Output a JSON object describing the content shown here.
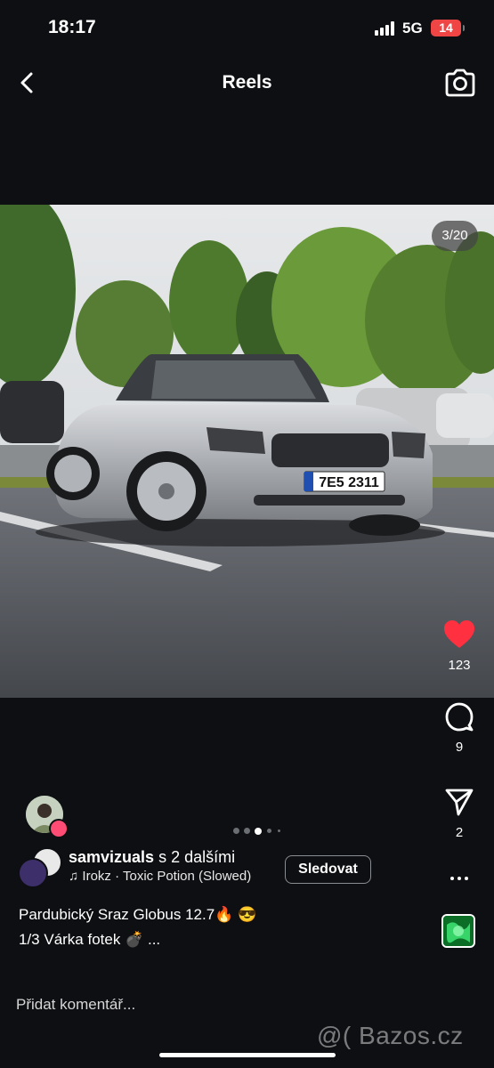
{
  "status_bar": {
    "time": "18:17",
    "network": "5G",
    "battery": "14"
  },
  "nav": {
    "back_icon": "chevron-left-icon",
    "title": "Reels",
    "camera_icon": "camera-icon"
  },
  "post": {
    "image": {
      "subject": "silver convertible car in parking lot",
      "license_plate": "7E5 2311",
      "counter": "3/20"
    },
    "carousel": {
      "total_dots": 5,
      "active_dot": 2
    },
    "likes": "123",
    "comments": "9",
    "shares": "2",
    "author": {
      "name": "samvizuals",
      "collab": "s 2 dalšími"
    },
    "music": {
      "icon": "music-note-icon",
      "text": "Irokz · Toxic Potion (Slowed)"
    },
    "follow_label": "Sledovat",
    "caption": {
      "line1": "Pardubický Sraz Globus 12.7",
      "line1_emoji": "🔥 😎",
      "line2": "1/3 Várka fotek",
      "line2_emoji": "💣",
      "more": "..."
    }
  },
  "comment_placeholder": "Přidat komentář...",
  "watermark": "@( Bazos.cz",
  "colors": {
    "background": "#0d0f12",
    "like": "#ff3040",
    "battery": "#f04545"
  }
}
